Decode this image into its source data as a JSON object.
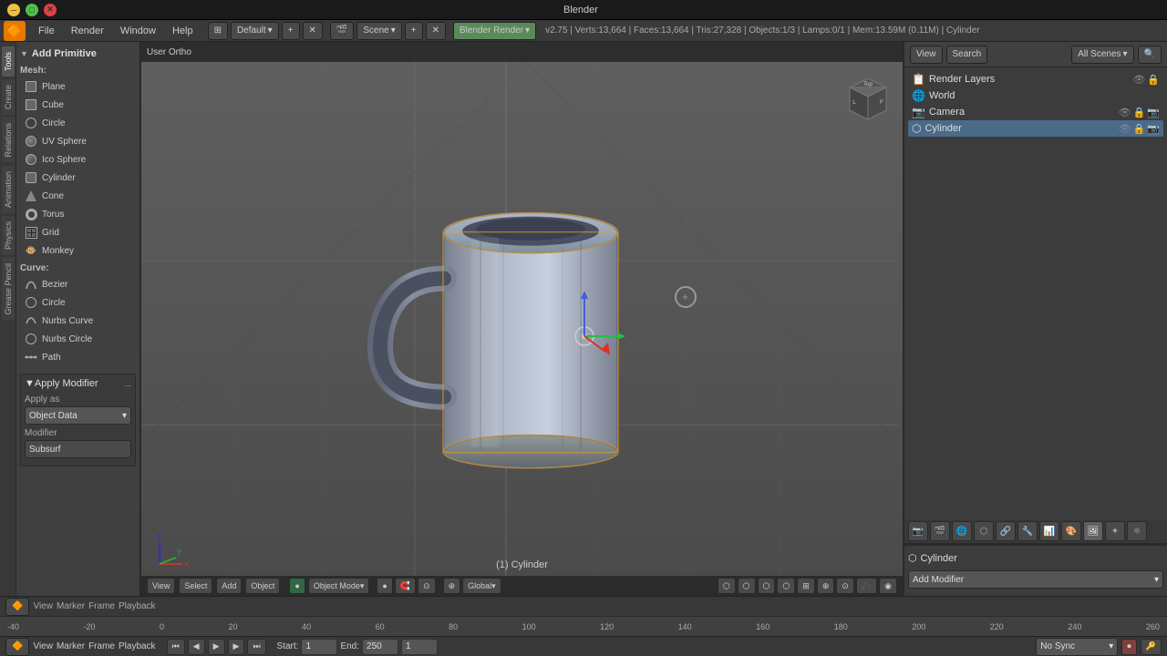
{
  "window": {
    "title": "Blender"
  },
  "titlebar": {
    "title": "Blender",
    "minimize": "─",
    "maximize": "□",
    "close": "✕",
    "icon": "●"
  },
  "menubar": {
    "icon": "🔵",
    "items": [
      "File",
      "Render",
      "Window",
      "Help"
    ],
    "workspace": "Default",
    "scene": "Scene",
    "engine": "Blender Render",
    "version_info": "v2.75 | Verts:13,664 | Faces:13,664 | Tris:27,328 | Objects:1/3 | Lamps:0/1 | Mem:13.59M (0.11M) | Cylinder"
  },
  "left_panel": {
    "header": "Add Primitive",
    "tabs": [
      "Tools",
      "Create",
      "Relations",
      "Animation",
      "Physics",
      "Grease Pencil"
    ],
    "mesh_label": "Mesh:",
    "mesh_items": [
      "Plane",
      "Cube",
      "Circle",
      "UV Sphere",
      "Ico Sphere",
      "Cylinder",
      "Cone",
      "Torus",
      "Grid",
      "Monkey"
    ],
    "curve_label": "Curve:",
    "curve_items": [
      "Bezier",
      "Circle",
      "Nurbs Curve",
      "Nurbs Circle",
      "Path"
    ],
    "apply_modifier_header": "Apply Modifier",
    "apply_as_label": "Apply as",
    "apply_as_value": "Object Data",
    "modifier_label": "Modifier",
    "modifier_value": "Subsurf"
  },
  "viewport": {
    "label": "User Ortho",
    "object_label": "(1) Cylinder",
    "mode": "Object Mode",
    "pivot": "●",
    "transform": "Global"
  },
  "right_panel": {
    "header_tabs": [
      "View",
      "Search"
    ],
    "scene_label": "All Scenes",
    "outliner_items": [
      {
        "name": "Render Layers",
        "icon": "📷",
        "indent": 0
      },
      {
        "name": "World",
        "icon": "🌐",
        "indent": 0
      },
      {
        "name": "Camera",
        "icon": "📷",
        "indent": 0
      },
      {
        "name": "Cylinder",
        "icon": "⬡",
        "indent": 0
      }
    ],
    "properties_object": "Cylinder",
    "add_modifier": "Add Modifier"
  },
  "timeline": {
    "start_label": "Start:",
    "start_value": "1",
    "end_label": "End:",
    "end_value": "250",
    "frame_value": "1",
    "sync_label": "No Sync"
  },
  "bottom_bar": {
    "mode_label": "Object Mode",
    "menus": [
      "View",
      "Select",
      "Add",
      "Object"
    ],
    "pivot_mode": "Object Mode",
    "transform_orientation": "Global"
  },
  "frame_numbers": [
    "-40",
    "-20",
    "0",
    "20",
    "40",
    "60",
    "80",
    "100",
    "120",
    "140",
    "160",
    "180",
    "200",
    "220",
    "240",
    "260"
  ]
}
